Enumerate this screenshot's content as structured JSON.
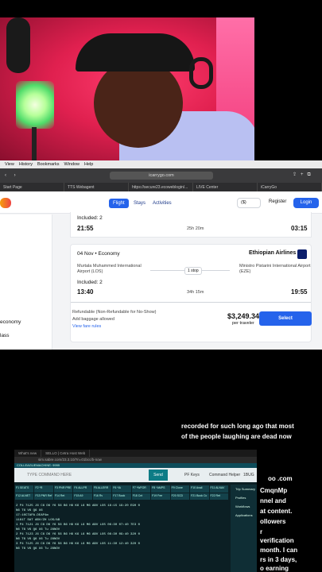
{
  "menubar": [
    "View",
    "History",
    "Bookmarks",
    "Window",
    "Help"
  ],
  "browser": {
    "url": "icarrygo.com",
    "tabs": [
      "Start Page",
      "TTS Webagent",
      "https://secure23.ecoweblogin/...",
      "LIVE Center",
      "iCarryGo"
    ]
  },
  "site": {
    "nav": {
      "flight": "Flight",
      "stays": "Stays",
      "activities": "Activities",
      "currency": "($)",
      "register": "Register",
      "login": "Login"
    },
    "left": {
      "l1": "economy",
      "l2": "lass"
    },
    "card1": {
      "included": "Included: 2",
      "dep": "21:55",
      "dur": "25h 20m",
      "arr": "03:15"
    },
    "card2": {
      "date": "04 Nov",
      "cabin": "Economy",
      "airline": "Ethiopian Airlines",
      "from": "Murtala Muhammed International Airport (LOS)",
      "stops": "1 stop",
      "to": "Ministro Pistarini International Airport (EZE)",
      "included": "Included: 2",
      "dep": "13:40",
      "dur": "34h 15m",
      "arr": "19:55",
      "refund": "Refundable (Non-Refundable for No-Show)",
      "baggage": "Add baggage allowed",
      "rules": "View fare rules",
      "price": "$3,249.34",
      "per": "per traveler",
      "select": "Select"
    }
  },
  "screen2": {
    "tabs": [
      "What's new",
      "SELLO | Cetra Host Web"
    ],
    "url": "sim.sabre.com/23.3.10/?n=01bcc/b-now",
    "bar": "COLLEAGUEMACHINE: 9999",
    "placeholder": "TYPE COMMAND HERE",
    "send": "Send",
    "pf": "PF Keys",
    "helper": "Command Helper",
    "right": "1BUG",
    "keys": [
      "F1 SEATS",
      "F2 *R",
      "F3 PNR PRE",
      "F4 ALLPR",
      "F5 ALLERR",
      "F6 *IA",
      "F7 *WFOR",
      "F8 *AMPS",
      "F9 Clone",
      "F10 Avail",
      "F11 ALNAV",
      "F12 ALNET",
      "F13 PNR Ref",
      "F14 Ret",
      "F15 A9",
      "F16 Rv",
      "F17 Book",
      "F18 Cnt",
      "F19 Fee",
      "F20 SCD",
      "F21 Book Cc",
      "F22 Ret"
    ],
    "side": [
      "Trip Summary",
      "Profiles",
      "Workflows",
      "Applications"
    ],
    "rows": [
      "2 P4   7125  J6 C6 D6 Y6 S6 B6 H6 K6 L6 M6   ABV  LOS        18:15     19:20     E90   0",
      "              N6 T6 V6 Q6 U6",
      "17:10CTAPA.DEAP4m",
      "1161T SAT ABV/ZH  LOS/AB",
      "1 P4   7121  J6 C6 D6 Y6 S6 B6 H6 K6 L6 M6   ABV  LOS        06:30     07:40     7E3   0",
      "              N6 T6 V6 Q6 U6            Tu 28NOV",
      "2 P4   7123  J6 C6 D6 Y6 S6 B6 H6 K6 L6 M6   ABV  LOS        08:30     09:40     320   0",
      "              N6 T6 V6 Q6 U6            Tu 28NOV",
      "3 P4   7125  J6 C6 D6 Y6 S6 B6 H6 K6 L6 M6   ABV  LOS        11:30     12:40     320   0",
      "              N6 T6 V6 Q6 U6            Tu 28NOV"
    ]
  },
  "captions": {
    "top1": "recorded for such long ago that most",
    "top2": "of the people laughing are dead now",
    "r1": "oo .com",
    "r2": "CmqnMp",
    "r3": "nnel and",
    "r4": "at content.",
    "r5": "ollowers",
    "r6": "r",
    "r7": "verification",
    "r8": "month. I can",
    "r9": "rs in 3 days,",
    "r10": "o earning"
  }
}
